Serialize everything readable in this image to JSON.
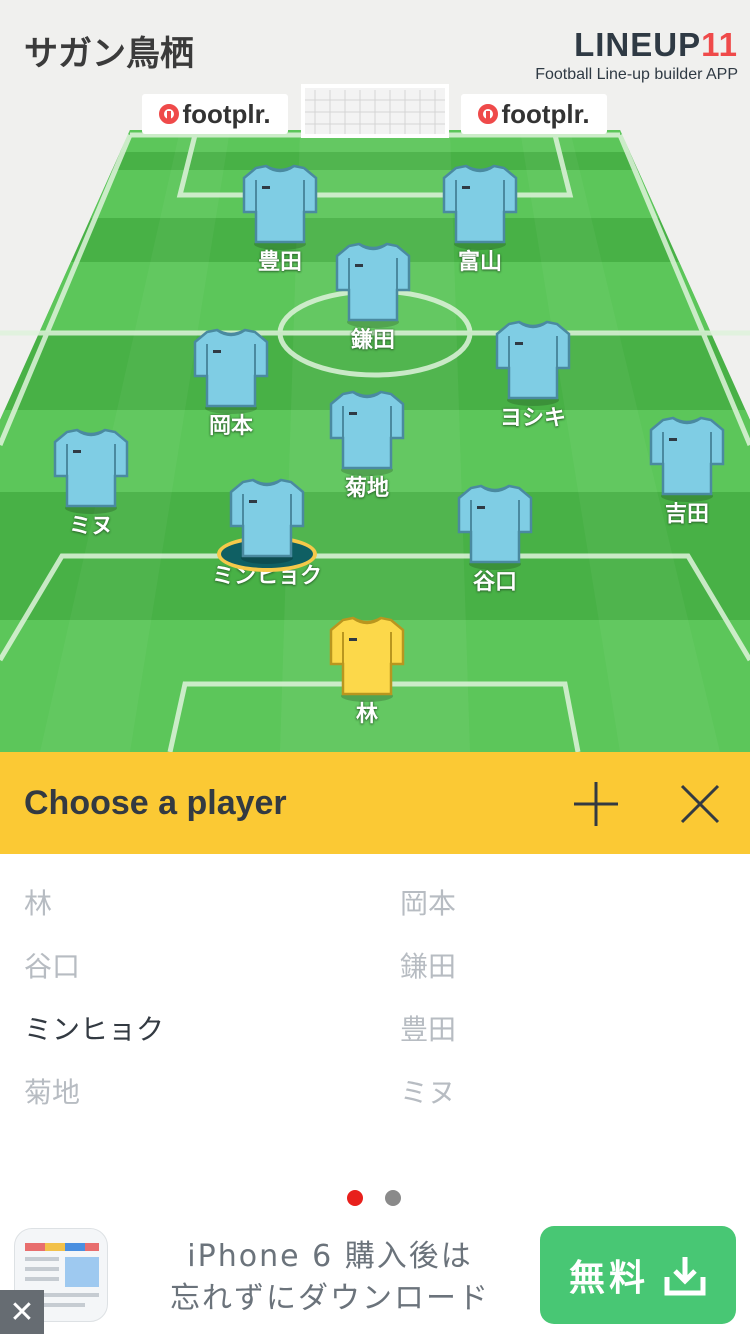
{
  "header": {
    "team_name": "サガン鳥栖",
    "brand_logo_text": "LINEUP",
    "brand_logo_number": "11",
    "brand_tagline": "Football Line-up builder APP",
    "sponsor_left": "footplr.",
    "sponsor_right": "footplr."
  },
  "colors": {
    "pitch_dark": "#3ea83e",
    "pitch_light": "#5cc65a",
    "outfield_shirt": "#7fcde4",
    "goalkeeper_shirt": "#fcd84a",
    "chooser_bar": "#fbc934",
    "accent_red": "#ef4a4a",
    "ad_button": "#48c774"
  },
  "pitch": {
    "players": [
      {
        "name": "豊田",
        "role": "outfield"
      },
      {
        "name": "富山",
        "role": "outfield"
      },
      {
        "name": "鎌田",
        "role": "outfield"
      },
      {
        "name": "岡本",
        "role": "outfield"
      },
      {
        "name": "ヨシキ",
        "role": "outfield"
      },
      {
        "name": "菊地",
        "role": "outfield"
      },
      {
        "name": "ミヌ",
        "role": "outfield"
      },
      {
        "name": "吉田",
        "role": "outfield"
      },
      {
        "name": "ミンヒョク",
        "role": "outfield",
        "selected": true
      },
      {
        "name": "谷口",
        "role": "outfield"
      },
      {
        "name": "林",
        "role": "goalkeeper"
      }
    ]
  },
  "chooser": {
    "title": "Choose a player",
    "add_icon": "plus-icon",
    "close_icon": "close-icon",
    "left_column": [
      "林",
      "谷口",
      "ミンヒョク",
      "菊地"
    ],
    "right_column": [
      "岡本",
      "鎌田",
      "豊田",
      "ミヌ"
    ],
    "active_item": "ミンヒョク",
    "page_count": 2,
    "current_page": 1
  },
  "ad": {
    "line1": "iPhone 6 購入後は",
    "line2": "忘れずにダウンロード",
    "button_label": "無料",
    "close_label": "✕"
  }
}
